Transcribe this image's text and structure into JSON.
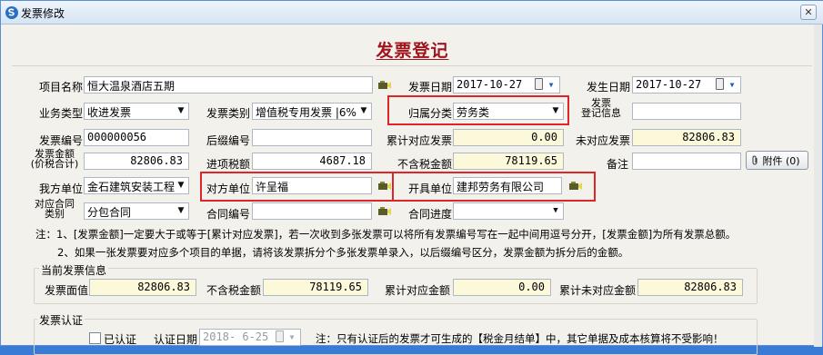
{
  "window": {
    "title": "发票修改",
    "close_label": "✕"
  },
  "heading": "发票登记",
  "form": {
    "project_name": {
      "label": "项目名称",
      "value": "恒大温泉酒店五期"
    },
    "invoice_date": {
      "label": "发票日期",
      "value": "2017-10-27"
    },
    "occur_date": {
      "label": "发生日期",
      "value": "2017-10-27"
    },
    "business_type": {
      "label": "业务类型",
      "value": "收进发票"
    },
    "invoice_category": {
      "label": "发票类别",
      "value": "增值税专用发票 |6%"
    },
    "classification": {
      "label": "归属分类",
      "value": "劳务类"
    },
    "register_info": {
      "label_line1": "发票",
      "label_line2": "登记信息",
      "value": ""
    },
    "invoice_number": {
      "label": "发票编号",
      "value": "000000056"
    },
    "suffix_number": {
      "label": "后缀编号",
      "value": ""
    },
    "cum_matched": {
      "label": "累计对应发票",
      "value": "0.00"
    },
    "unmatched": {
      "label": "未对应发票",
      "value": "82806.83"
    },
    "invoice_amount": {
      "label_line1": "发票金额",
      "label_line2": "(价税合计)",
      "value": "82806.83"
    },
    "input_tax": {
      "label": "进项税额",
      "value": "4687.18"
    },
    "amount_ex_tax": {
      "label": "不含税金额",
      "value": "78119.65"
    },
    "remark": {
      "label": "备注",
      "value": ""
    },
    "attachment_label": "附件 (0)",
    "our_unit": {
      "label": "我方单位",
      "value": "金石建筑安装工程"
    },
    "counterparty": {
      "label": "对方单位",
      "value": "许呈福"
    },
    "issuing_unit": {
      "label": "开具单位",
      "value": "建邦劳务有限公司"
    },
    "contract_category": {
      "label_line1": "对应合同",
      "label_line2": "类别",
      "value": "分包合同"
    },
    "contract_number": {
      "label": "合同编号",
      "value": ""
    },
    "contract_progress": {
      "label": "合同进度",
      "value": ""
    }
  },
  "notes": [
    "注：1、[发票金额]一定要大于或等于[累计对应发票]，若一次收到多张发票可以将所有发票编号写在一起中间用逗号分开，[发票金额]为所有发票总额。",
    "2、如果一张发票要对应多个项目的单据，请将该发票拆分个多张发票单录入，以后缀编号区分，发票金额为拆分后的金额。"
  ],
  "current_info": {
    "title": "当前发票信息",
    "face_value": {
      "label": "发票面值",
      "value": "82806.83"
    },
    "ex_tax": {
      "label": "不含税金额",
      "value": "78119.65"
    },
    "cum_matched": {
      "label": "累计对应金额",
      "value": "0.00"
    },
    "cum_unmatched": {
      "label": "累计未对应金额",
      "value": "82806.83"
    }
  },
  "certification": {
    "title": "发票认证",
    "checkbox_label": "已认证",
    "date_label": "认证日期",
    "date_value": "2018- 6-25",
    "note": "注：只有认证后的发票才可生成的【税金月结单】中，其它单据及成本核算将不受影响！"
  },
  "colors": {
    "heading": "#a0141d",
    "highlight": "#e0242a",
    "readonly_bg": "#fcf9da"
  }
}
